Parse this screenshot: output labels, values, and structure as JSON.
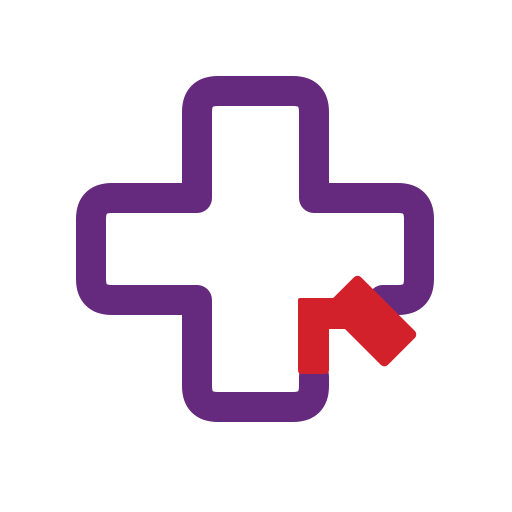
{
  "logo": {
    "semantic": "medical-cross-with-cursor-logo",
    "colors": {
      "cross_outline": "#652a7e",
      "cursor_arrow": "#d3212c",
      "background": "#ffffff"
    }
  }
}
